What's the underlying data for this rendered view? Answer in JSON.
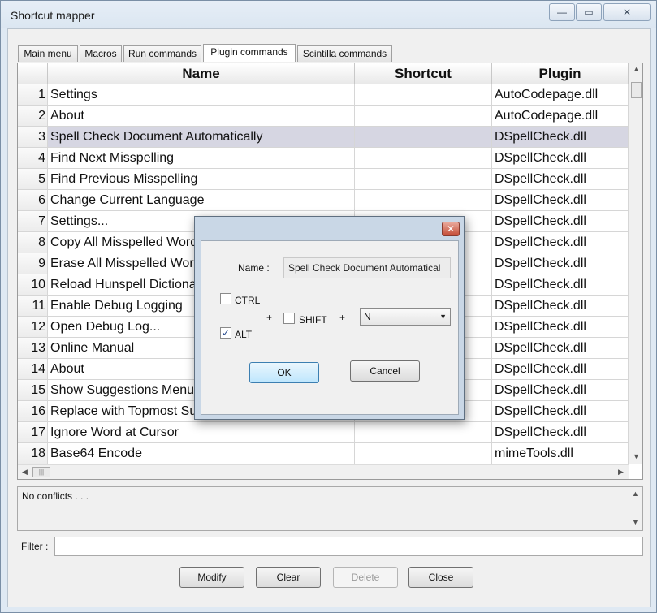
{
  "window": {
    "title": "Shortcut mapper",
    "minimize_glyph": "—",
    "maximize_glyph": "▭",
    "close_glyph": "✕"
  },
  "tabs": [
    {
      "label": "Main menu"
    },
    {
      "label": "Macros"
    },
    {
      "label": "Run commands"
    },
    {
      "label": "Plugin commands",
      "active": true
    },
    {
      "label": "Scintilla commands"
    }
  ],
  "grid": {
    "columns": {
      "name": "Name",
      "shortcut": "Shortcut",
      "plugin": "Plugin"
    },
    "rows": [
      {
        "num": "1",
        "name": "Settings",
        "shortcut": "",
        "plugin": "AutoCodepage.dll"
      },
      {
        "num": "2",
        "name": "About",
        "shortcut": "",
        "plugin": "AutoCodepage.dll"
      },
      {
        "num": "3",
        "name": "Spell Check Document Automatically",
        "shortcut": "",
        "plugin": "DSpellCheck.dll"
      },
      {
        "num": "4",
        "name": "Find Next Misspelling",
        "shortcut": "",
        "plugin": "DSpellCheck.dll"
      },
      {
        "num": "5",
        "name": "Find Previous Misspelling",
        "shortcut": "",
        "plugin": "DSpellCheck.dll"
      },
      {
        "num": "6",
        "name": "Change Current Language",
        "shortcut": "",
        "plugin": "DSpellCheck.dll"
      },
      {
        "num": "7",
        "name": "Settings...",
        "shortcut": "",
        "plugin": "DSpellCheck.dll"
      },
      {
        "num": "8",
        "name": "Copy All Misspelled Words",
        "shortcut": "",
        "plugin": "DSpellCheck.dll"
      },
      {
        "num": "9",
        "name": "Erase All Misspelled Word",
        "shortcut": "",
        "plugin": "DSpellCheck.dll"
      },
      {
        "num": "10",
        "name": "Reload Hunspell Dictiona",
        "shortcut": "",
        "plugin": "DSpellCheck.dll"
      },
      {
        "num": "11",
        "name": "Enable Debug Logging",
        "shortcut": "",
        "plugin": "DSpellCheck.dll"
      },
      {
        "num": "12",
        "name": "Open Debug Log...",
        "shortcut": "",
        "plugin": "DSpellCheck.dll"
      },
      {
        "num": "13",
        "name": "Online Manual",
        "shortcut": "",
        "plugin": "DSpellCheck.dll"
      },
      {
        "num": "14",
        "name": "About",
        "shortcut": "",
        "plugin": "DSpellCheck.dll"
      },
      {
        "num": "15",
        "name": "Show Suggestions Menu",
        "shortcut": "",
        "plugin": "DSpellCheck.dll"
      },
      {
        "num": "16",
        "name": "Replace with Topmost Su",
        "shortcut": "",
        "plugin": "DSpellCheck.dll"
      },
      {
        "num": "17",
        "name": "Ignore Word at Cursor",
        "shortcut": "",
        "plugin": "DSpellCheck.dll"
      },
      {
        "num": "18",
        "name": "Base64 Encode",
        "shortcut": "",
        "plugin": "mimeTools.dll"
      }
    ],
    "selected_row": "3"
  },
  "conflicts": {
    "text": "No conflicts . . ."
  },
  "filter": {
    "label": "Filter :",
    "value": ""
  },
  "buttons": {
    "modify": "Modify",
    "clear": "Clear",
    "delete": "Delete",
    "close": "Close"
  },
  "dialog": {
    "close_glyph": "✕",
    "name_label": "Name :",
    "name_value": "Spell Check Document Automatical",
    "ctrl_label": "CTRL",
    "alt_label": "ALT",
    "shift_label": "SHIFT",
    "plus": "+",
    "key_value": "N",
    "ok": "OK",
    "cancel": "Cancel",
    "ctrl_checked": false,
    "alt_checked": true,
    "shift_checked": false
  }
}
